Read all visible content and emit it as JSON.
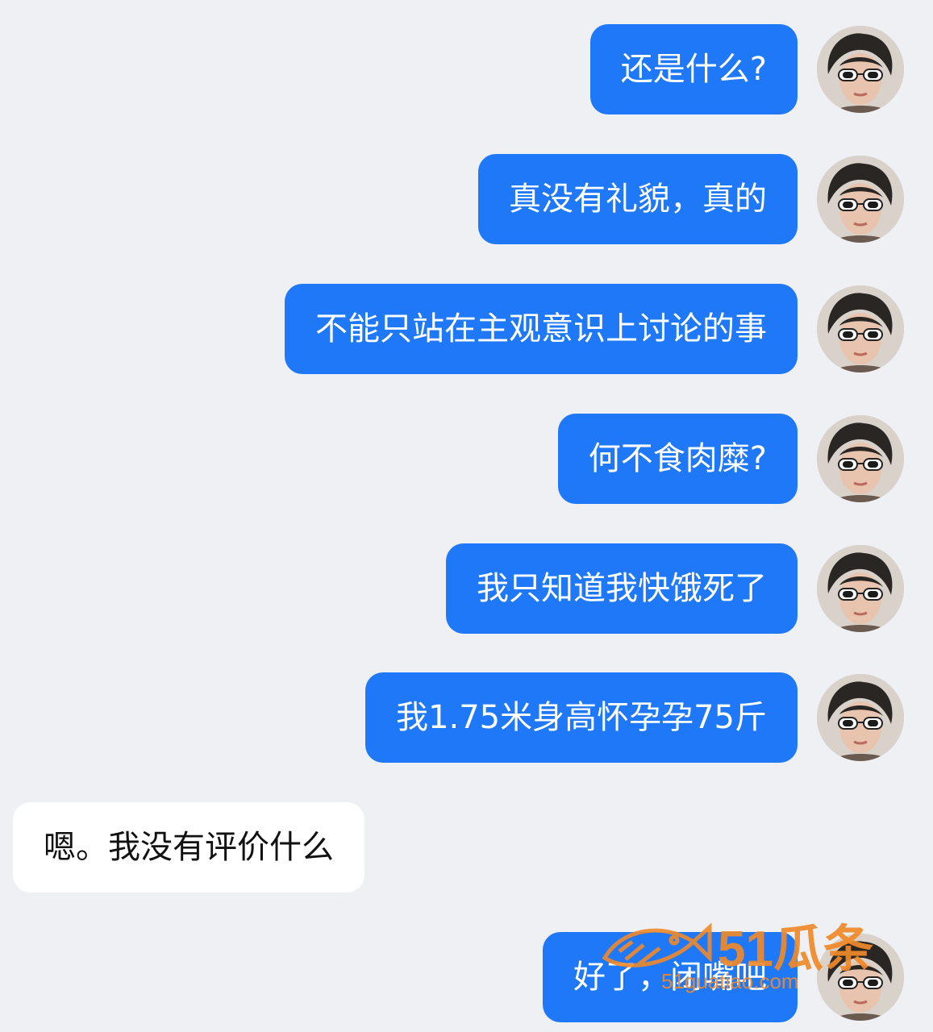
{
  "messages": [
    {
      "side": "me",
      "text": "还是什么?"
    },
    {
      "side": "me",
      "text": "真没有礼貌，真的"
    },
    {
      "side": "me",
      "text": "不能只站在主观意识上讨论的事"
    },
    {
      "side": "me",
      "text": "何不食肉糜?"
    },
    {
      "side": "me",
      "text": "我只知道我快饿死了"
    },
    {
      "side": "me",
      "text": "我1.75米身高怀孕孕75斤"
    },
    {
      "side": "other",
      "text": "嗯。我没有评价什么"
    },
    {
      "side": "me",
      "text": "好了，闭嘴吧"
    }
  ],
  "colors": {
    "background": "#eef0f4",
    "my_bubble": "#1f78f7",
    "other_bubble": "#ffffff",
    "watermark": "#f08a2a"
  },
  "watermark": {
    "brand": "51瓜条",
    "url": "51guatiao.com"
  }
}
